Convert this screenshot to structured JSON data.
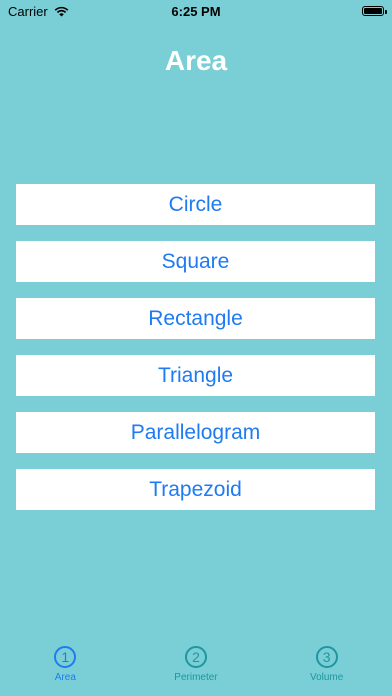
{
  "status": {
    "carrier": "Carrier",
    "time": "6:25 PM"
  },
  "header": {
    "title": "Area"
  },
  "shapes": [
    {
      "label": "Circle"
    },
    {
      "label": "Square"
    },
    {
      "label": "Rectangle"
    },
    {
      "label": "Triangle"
    },
    {
      "label": "Parallelogram"
    },
    {
      "label": "Trapezoid"
    }
  ],
  "tabs": [
    {
      "icon": "1",
      "label": "Area",
      "active": true
    },
    {
      "icon": "2",
      "label": "Perimeter",
      "active": false
    },
    {
      "icon": "3",
      "label": "Volume",
      "active": false
    }
  ],
  "colors": {
    "background": "#7ACFD6",
    "accent": "#1E7BF2",
    "tab_inactive": "#1F96A0"
  }
}
